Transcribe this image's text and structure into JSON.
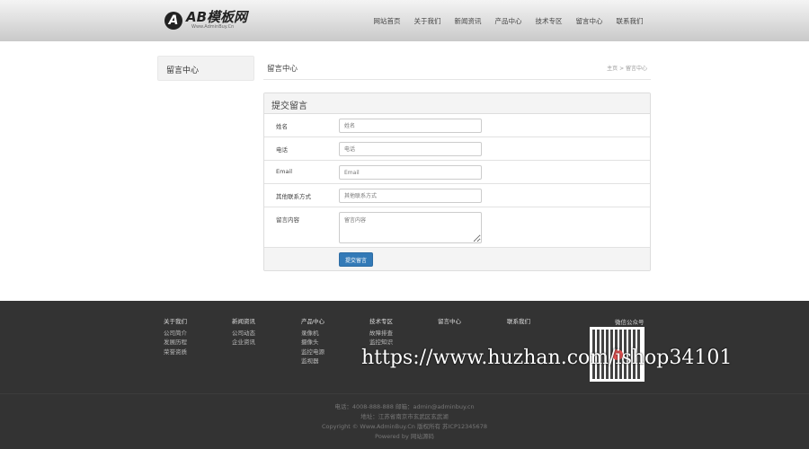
{
  "header": {
    "logo_letter": "A",
    "logo_main": "AB模板网",
    "logo_sub": "Www.AdminBuy.Cn",
    "nav": [
      "网站首页",
      "关于我们",
      "新闻资讯",
      "产品中心",
      "技术专区",
      "留言中心",
      "联系我们"
    ]
  },
  "sidebar": {
    "title": "留言中心"
  },
  "main": {
    "title": "留言中心",
    "breadcrumb": "主页 > 留言中心"
  },
  "form": {
    "title": "提交留言",
    "fields": [
      {
        "label": "姓名",
        "placeholder": "姓名"
      },
      {
        "label": "电话",
        "placeholder": "电话"
      },
      {
        "label": "Email",
        "placeholder": "Email"
      },
      {
        "label": "其他联系方式",
        "placeholder": "其他联系方式"
      },
      {
        "label": "留言内容",
        "placeholder": "留言内容"
      }
    ],
    "submit": "提交留言"
  },
  "footer": {
    "columns": [
      {
        "title": "关于我们",
        "items": [
          "公司简介",
          "发展历程",
          "荣誉资质"
        ]
      },
      {
        "title": "新闻资讯",
        "items": [
          "公司动态",
          "企业资讯"
        ]
      },
      {
        "title": "产品中心",
        "items": [
          "录像机",
          "摄像头",
          "监控电源",
          "监视器"
        ]
      },
      {
        "title": "技术专区",
        "items": [
          "故障排查",
          "监控知识"
        ]
      },
      {
        "title": "留言中心",
        "items": []
      },
      {
        "title": "联系我们",
        "items": []
      }
    ],
    "qr_title": "微信公众号",
    "lines": [
      "电话：4008-888-888 邮箱：admin@adminbuy.cn",
      "地址：江苏省南京市玄武区玄武湖",
      "Copyright © Www.AdminBuy.Cn 版权所有 苏ICP12345678",
      "Powered by 网站源码"
    ]
  },
  "watermark": "https://www.huzhan.com/ishop34101"
}
